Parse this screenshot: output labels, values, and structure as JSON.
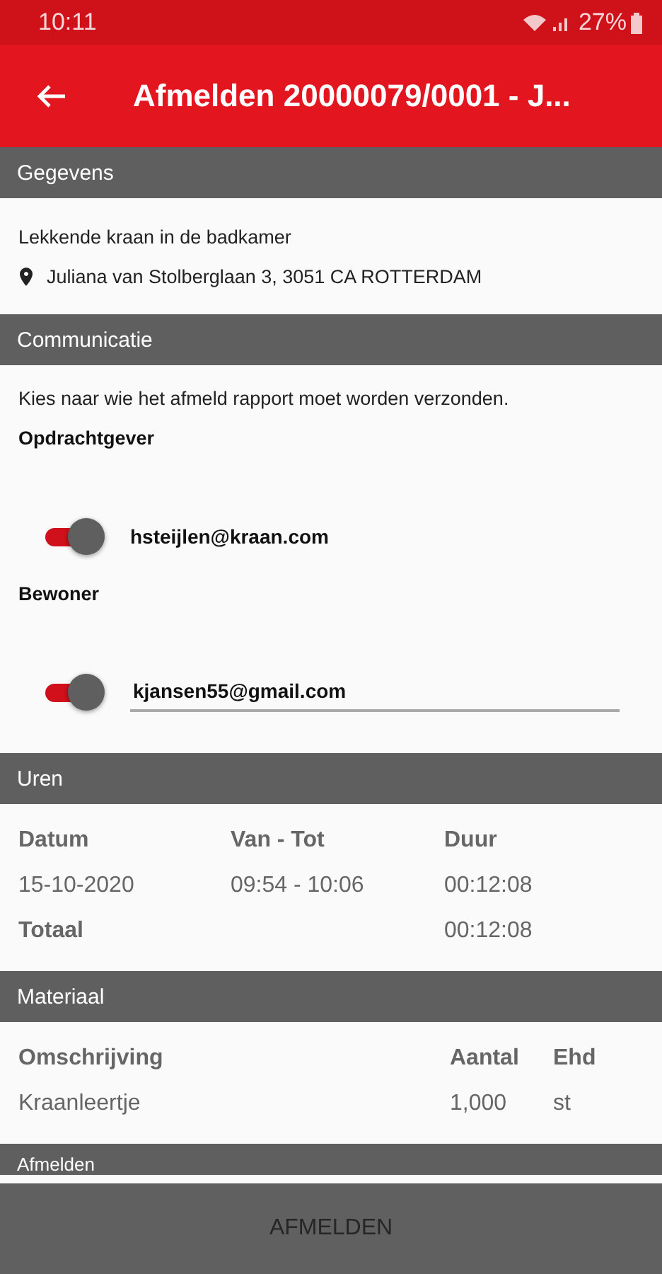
{
  "status_bar": {
    "time": "10:11",
    "battery": "27%"
  },
  "app_bar": {
    "title": "Afmelden 20000079/0001 - J..."
  },
  "gegevens": {
    "header": "Gegevens",
    "description": "Lekkende kraan in de badkamer",
    "address": "Juliana van Stolberglaan 3, 3051 CA ROTTERDAM"
  },
  "communicatie": {
    "header": "Communicatie",
    "instruction": "Kies naar wie het afmeld rapport moet worden verzonden.",
    "recipients": [
      {
        "label": "Opdrachtgever",
        "kind": "text",
        "on": true,
        "email": "hsteijlen@kraan.com"
      },
      {
        "label": "Bewoner",
        "kind": "input",
        "on": true,
        "email": "kjansen55@gmail.com"
      }
    ]
  },
  "uren": {
    "header": "Uren",
    "columns": [
      "Datum",
      "Van - Tot",
      "Duur"
    ],
    "rows": [
      [
        "15-10-2020",
        "09:54 - 10:06",
        "00:12:08"
      ]
    ],
    "total_label": "Totaal",
    "total": "00:12:08"
  },
  "materiaal": {
    "header": "Materiaal",
    "columns": [
      "Omschrijving",
      "Aantal",
      "Ehd"
    ],
    "rows": [
      [
        "Kraanleertje",
        "1,000",
        "st"
      ]
    ]
  },
  "afmelden": {
    "header": "Afmelden"
  },
  "submit_button": {
    "label": "AFMELDEN",
    "disabled": true
  }
}
